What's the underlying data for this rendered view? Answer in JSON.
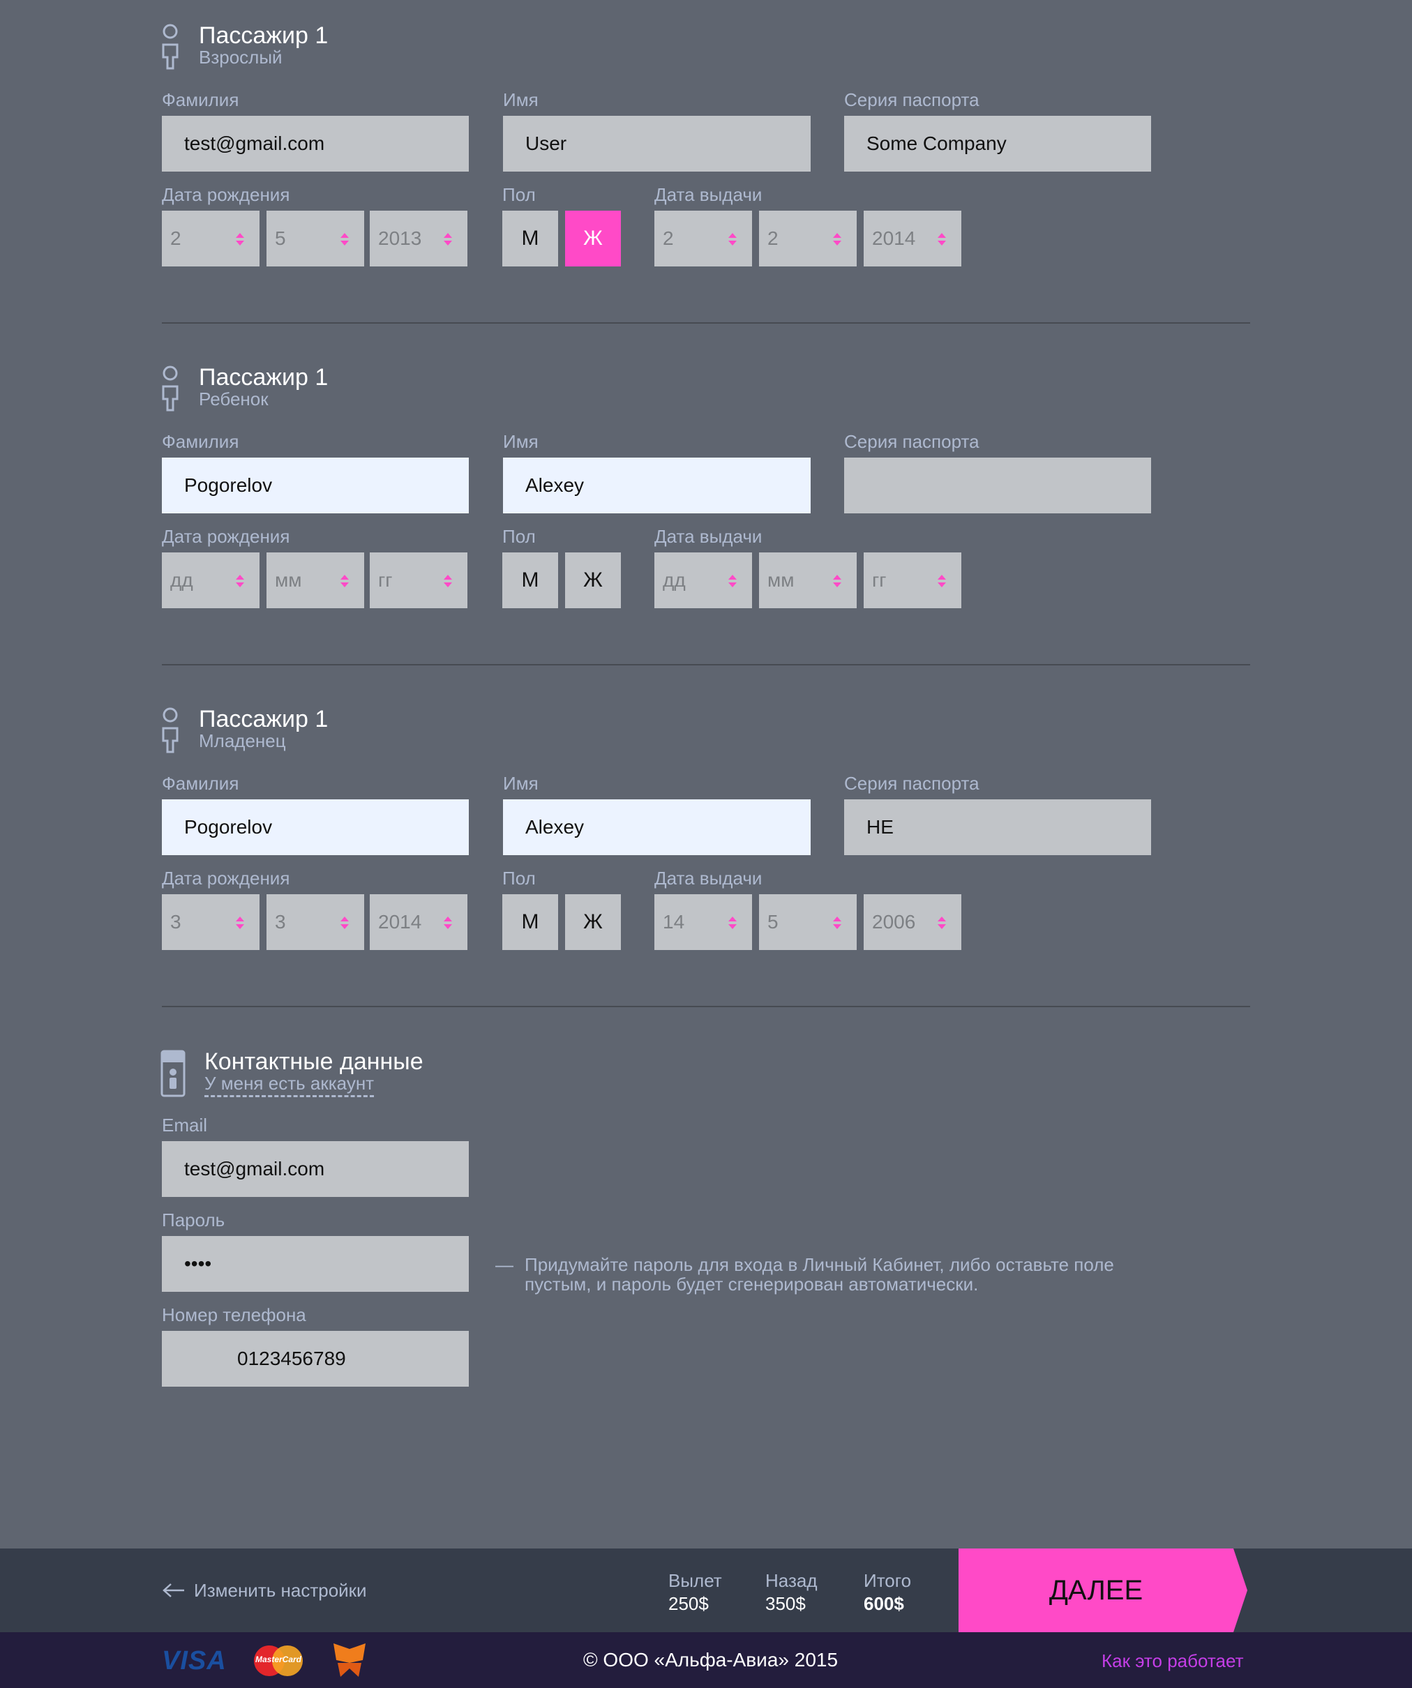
{
  "passengers": [
    {
      "title": "Пассажир 1",
      "type": "Взрослый",
      "surname_label": "Фамилия",
      "surname": "test@gmail.com",
      "name_label": "Имя",
      "name": "User",
      "passport_label": "Серия паспорта",
      "passport": "Some Company",
      "birth_label": "Дата рождения",
      "birth": [
        "2",
        "5",
        "2013"
      ],
      "sex_label": "Пол",
      "sex_m": "М",
      "sex_f": "Ж",
      "selected_sex": "Ж",
      "issue_label": "Дата выдачи",
      "issue": [
        "2",
        "2",
        "2014"
      ]
    },
    {
      "title": "Пассажир 1",
      "type": "Ребенок",
      "surname_label": "Фамилия",
      "surname": "Pogorelov",
      "name_label": "Имя",
      "name": "Alexey",
      "passport_label": "Серия паспорта",
      "passport": "",
      "birth_label": "Дата рождения",
      "birth": [
        "дд",
        "мм",
        "гг"
      ],
      "sex_label": "Пол",
      "sex_m": "М",
      "sex_f": "Ж",
      "selected_sex": "",
      "issue_label": "Дата выдачи",
      "issue": [
        "дд",
        "мм",
        "гг"
      ]
    },
    {
      "title": "Пассажир 1",
      "type": "Младенец",
      "surname_label": "Фамилия",
      "surname": "Pogorelov",
      "name_label": "Имя",
      "name": "Alexey",
      "passport_label": "Серия паспорта",
      "passport": "НЕ",
      "birth_label": "Дата рождения",
      "birth": [
        "3",
        "3",
        "2014"
      ],
      "sex_label": "Пол",
      "sex_m": "М",
      "sex_f": "Ж",
      "selected_sex": "",
      "issue_label": "Дата выдачи",
      "issue": [
        "14",
        "5",
        "2006"
      ]
    }
  ],
  "contact": {
    "title": "Контактные данные",
    "account_link": "У меня есть аккаунт",
    "email_label": "Email",
    "email": "test@gmail.com",
    "password_label": "Пароль",
    "password": "••••",
    "password_hint_dash": "—",
    "password_hint_line1": "Придумайте пароль для входа в Личный Кабинет, либо оставьте поле",
    "password_hint_line2": "пустым, и пароль будет сгенерирован автоматически.",
    "phone_label": "Номер телефона",
    "phone": "0123456789"
  },
  "footer": {
    "back_arrow_icon": "arrow-left-icon",
    "back_label": "Изменить настройки",
    "departure_label": "Вылет",
    "departure_value": "250$",
    "return_label": "Назад",
    "return_value": "350$",
    "total_label": "Итого",
    "total_value": "600$",
    "next_button": "ДАЛЕЕ"
  },
  "bottom": {
    "visa": "VISA",
    "mastercard": "MasterCard",
    "copyright": "© ООО «Альфа-Авиа» 2015",
    "how_it_works": "Как это работает"
  },
  "colors": {
    "background": "#5f6570",
    "accent": "#ff4ac7",
    "label": "#aeb9cf",
    "footer": "#363d4a",
    "bottom_bar": "#231d3d",
    "link": "#c43ee6"
  }
}
